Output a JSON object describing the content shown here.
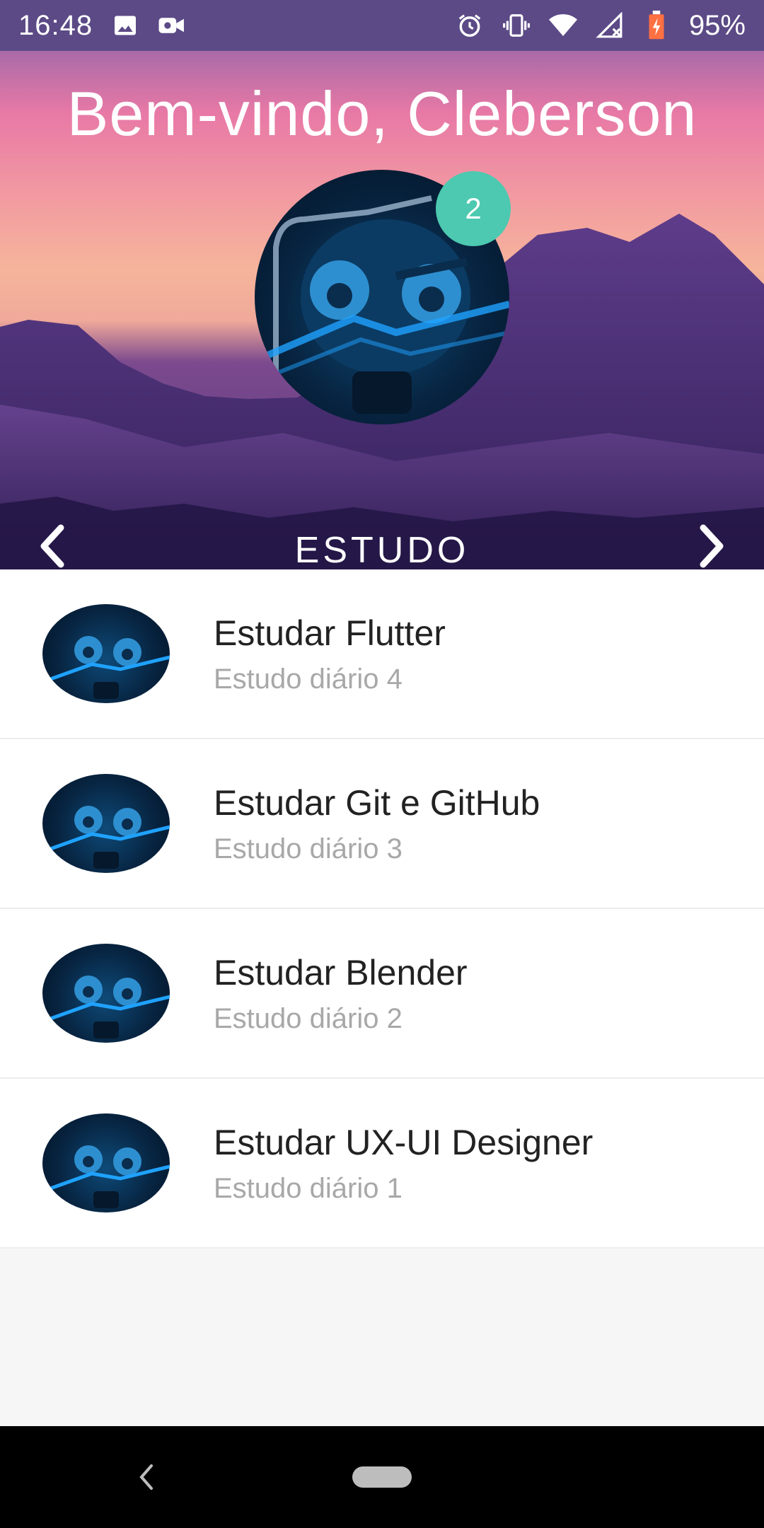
{
  "status_bar": {
    "time": "16:48",
    "battery": "95%",
    "icons": [
      "image-icon",
      "video-icon",
      "alarm-icon",
      "vibrate-icon",
      "wifi-icon",
      "signal-icon",
      "battery-icon"
    ]
  },
  "header": {
    "title": "Bem-vindo, Cleberson",
    "badge_count": "2",
    "category": "ESTUDO"
  },
  "tasks": [
    {
      "title": "Estudar Flutter",
      "subtitle": "Estudo diário 4"
    },
    {
      "title": "Estudar Git e GitHub",
      "subtitle": "Estudo diário 3"
    },
    {
      "title": "Estudar Blender",
      "subtitle": "Estudo diário 2"
    },
    {
      "title": "Estudar UX-UI Designer",
      "subtitle": "Estudo diário 1"
    }
  ],
  "colors": {
    "status_bar": "#5b4a86",
    "badge": "#4cc9b0",
    "title_text": "#222222",
    "subtitle_text": "#a8a8a8"
  }
}
